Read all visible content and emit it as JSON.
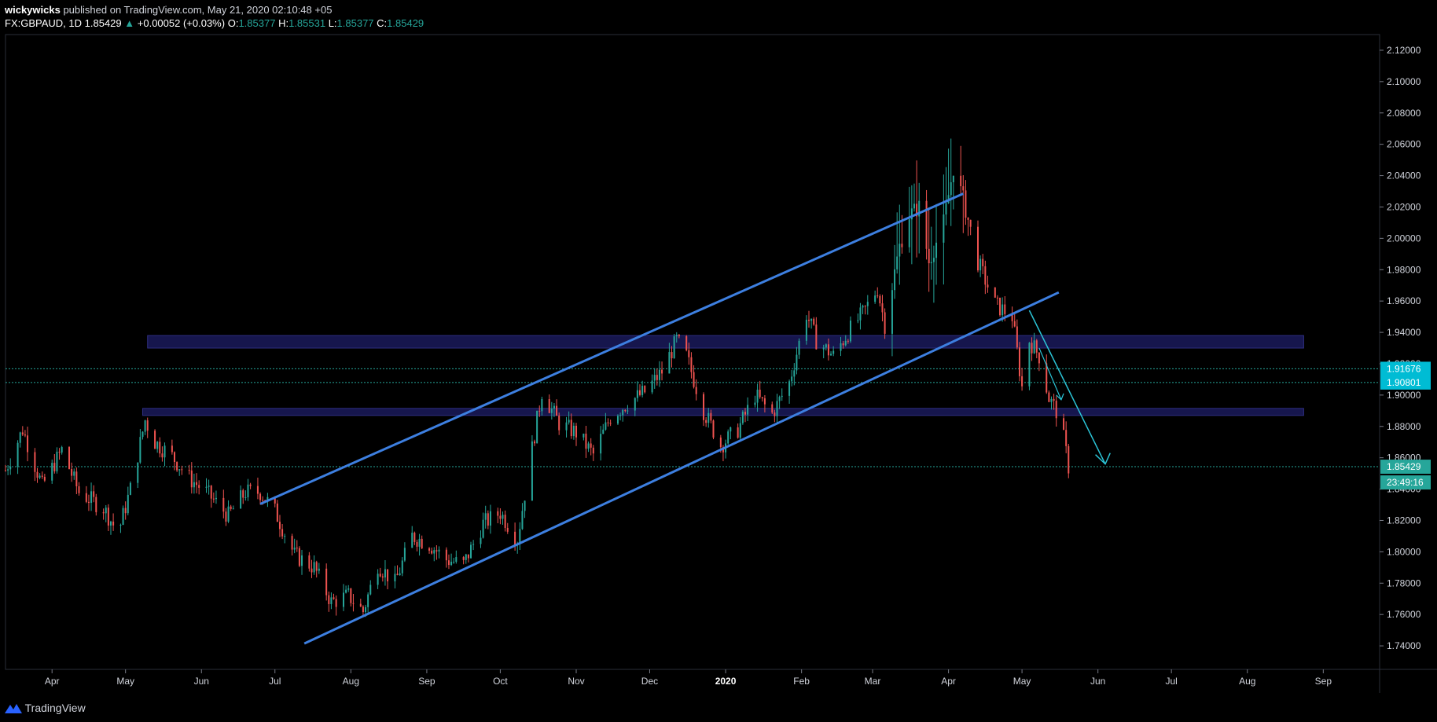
{
  "header": {
    "author": "wickywicks",
    "published_text": "published on TradingView.com, May 21, 2020 02:10:48 +05",
    "symbol": "FX:GBPAUD, 1D",
    "last": "1.85429",
    "change": "+0.00052 (+0.03%)",
    "o_label": "O:",
    "o_value": "1.85377",
    "h_label": "H:",
    "h_value": "1.85531",
    "l_label": "L:",
    "l_value": "1.85377",
    "c_label": "C:",
    "c_value": "1.85429"
  },
  "footer": {
    "brand": "TradingView"
  },
  "colors": {
    "up": "#26a69a",
    "down": "#ef5350",
    "channel": "#3d7fe0",
    "arrow": "#2bc4d6",
    "zone": "#1a1a5a",
    "level_line": "#26a69a"
  },
  "chart_data": {
    "type": "candlestick",
    "symbol": "FX:GBPAUD",
    "interval": "1D",
    "ylim": [
      1.725,
      2.13
    ],
    "y_ticks": [
      "1.74000",
      "1.76000",
      "1.78000",
      "1.80000",
      "1.82000",
      "1.84000",
      "1.86000",
      "1.88000",
      "1.90000",
      "1.92000",
      "1.94000",
      "1.96000",
      "1.98000",
      "2.00000",
      "2.02000",
      "2.04000",
      "2.06000",
      "2.08000",
      "2.10000",
      "2.12000"
    ],
    "x_ticks": [
      "Apr",
      "May",
      "Jun",
      "Jul",
      "Aug",
      "Sep",
      "Oct",
      "Nov",
      "Dec",
      "2020",
      "Feb",
      "Mar",
      "Apr",
      "May",
      "Jun",
      "Jul",
      "Aug",
      "Sep"
    ],
    "x_domain": [
      "2019-03-13",
      "2020-09-24"
    ],
    "last_price_label": "1.85429",
    "countdown_label": "23:49:16",
    "level_labels": [
      "1.91676",
      "1.90801"
    ],
    "levels": [
      1.91676,
      1.90801,
      1.85429
    ],
    "close_path": [
      [
        "2019-03-13",
        1.852
      ],
      [
        "2019-03-20",
        1.878
      ],
      [
        "2019-03-28",
        1.842
      ],
      [
        "2019-04-05",
        1.865
      ],
      [
        "2019-04-12",
        1.838
      ],
      [
        "2019-04-22",
        1.828
      ],
      [
        "2019-04-28",
        1.812
      ],
      [
        "2019-05-03",
        1.84
      ],
      [
        "2019-05-09",
        1.884
      ],
      [
        "2019-05-13",
        1.87
      ],
      [
        "2019-05-20",
        1.861
      ],
      [
        "2019-05-27",
        1.847
      ],
      [
        "2019-06-03",
        1.838
      ],
      [
        "2019-06-12",
        1.823
      ],
      [
        "2019-06-19",
        1.838
      ],
      [
        "2019-06-25",
        1.838
      ],
      [
        "2019-07-01",
        1.826
      ],
      [
        "2019-07-09",
        1.798
      ],
      [
        "2019-07-17",
        1.79
      ],
      [
        "2019-07-24",
        1.768
      ],
      [
        "2019-07-31",
        1.772
      ],
      [
        "2019-08-06",
        1.762
      ],
      [
        "2019-08-12",
        1.792
      ],
      [
        "2019-08-19",
        1.78
      ],
      [
        "2019-08-26",
        1.81
      ],
      [
        "2019-09-02",
        1.805
      ],
      [
        "2019-09-09",
        1.795
      ],
      [
        "2019-09-16",
        1.792
      ],
      [
        "2019-09-24",
        1.818
      ],
      [
        "2019-10-01",
        1.825
      ],
      [
        "2019-10-08",
        1.808
      ],
      [
        "2019-10-14",
        1.866
      ],
      [
        "2019-10-18",
        1.902
      ],
      [
        "2019-10-25",
        1.882
      ],
      [
        "2019-11-01",
        1.876
      ],
      [
        "2019-11-08",
        1.862
      ],
      [
        "2019-11-15",
        1.886
      ],
      [
        "2019-11-22",
        1.895
      ],
      [
        "2019-11-29",
        1.902
      ],
      [
        "2019-12-06",
        1.915
      ],
      [
        "2019-12-12",
        1.935
      ],
      [
        "2019-12-16",
        1.925
      ],
      [
        "2019-12-23",
        1.89
      ],
      [
        "2019-12-30",
        1.868
      ],
      [
        "2020-01-06",
        1.878
      ],
      [
        "2020-01-13",
        1.9
      ],
      [
        "2020-01-20",
        1.888
      ],
      [
        "2020-01-27",
        1.908
      ],
      [
        "2020-02-03",
        1.952
      ],
      [
        "2020-02-07",
        1.935
      ],
      [
        "2020-02-14",
        1.925
      ],
      [
        "2020-02-20",
        1.94
      ],
      [
        "2020-02-26",
        1.952
      ],
      [
        "2020-03-03",
        1.968
      ],
      [
        "2020-03-06",
        1.945
      ],
      [
        "2020-03-12",
        1.995
      ],
      [
        "2020-03-16",
        2.015
      ],
      [
        "2020-03-20",
        2.02
      ],
      [
        "2020-03-24",
        1.985
      ],
      [
        "2020-03-30",
        2.01
      ],
      [
        "2020-04-03",
        2.045
      ],
      [
        "2020-04-07",
        2.025
      ],
      [
        "2020-04-13",
        1.985
      ],
      [
        "2020-04-20",
        1.958
      ],
      [
        "2020-04-27",
        1.95
      ],
      [
        "2020-05-01",
        1.905
      ],
      [
        "2020-05-04",
        1.935
      ],
      [
        "2020-05-08",
        1.925
      ],
      [
        "2020-05-12",
        1.898
      ],
      [
        "2020-05-15",
        1.89
      ],
      [
        "2020-05-18",
        1.872
      ],
      [
        "2020-05-20",
        1.8543
      ]
    ]
  }
}
